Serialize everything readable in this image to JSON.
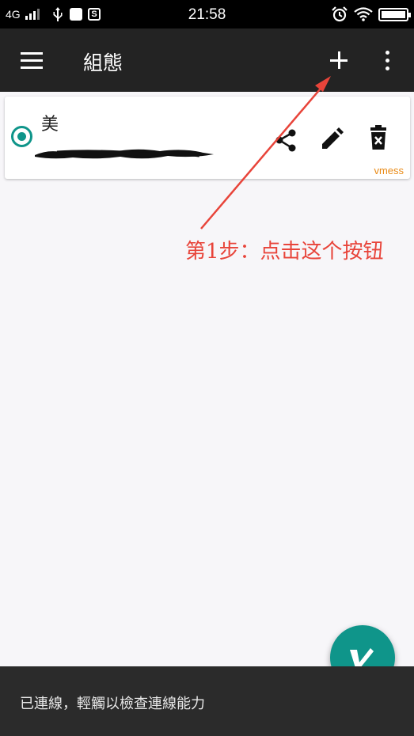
{
  "status_bar": {
    "network": "4G",
    "time": "21:58",
    "app_icon_label": "S",
    "icons": [
      "signal-icon",
      "usb-icon",
      "app-notification-icon",
      "app-notification-icon",
      "alarm-icon",
      "wifi-icon",
      "battery-icon"
    ]
  },
  "app_bar": {
    "title": "組態",
    "icons": [
      "menu-icon",
      "add-icon",
      "more-vert-icon"
    ]
  },
  "server_card": {
    "name": "美",
    "protocol": "vmess",
    "selected": true,
    "address_redacted": true,
    "icons": [
      "radio-selected-icon",
      "share-icon",
      "edit-icon",
      "delete-icon"
    ]
  },
  "annotation": {
    "text": "第1步：点击这个按钮",
    "color": "#e8443a"
  },
  "fab": {
    "icon": "v-logo-icon",
    "color": "#0f958a"
  },
  "footer": {
    "status_text": "已連線，輕觸以檢查連線能力"
  },
  "colors": {
    "accent": "#0f958a",
    "app_bar": "#232323",
    "protocol_label": "#e98a16"
  }
}
